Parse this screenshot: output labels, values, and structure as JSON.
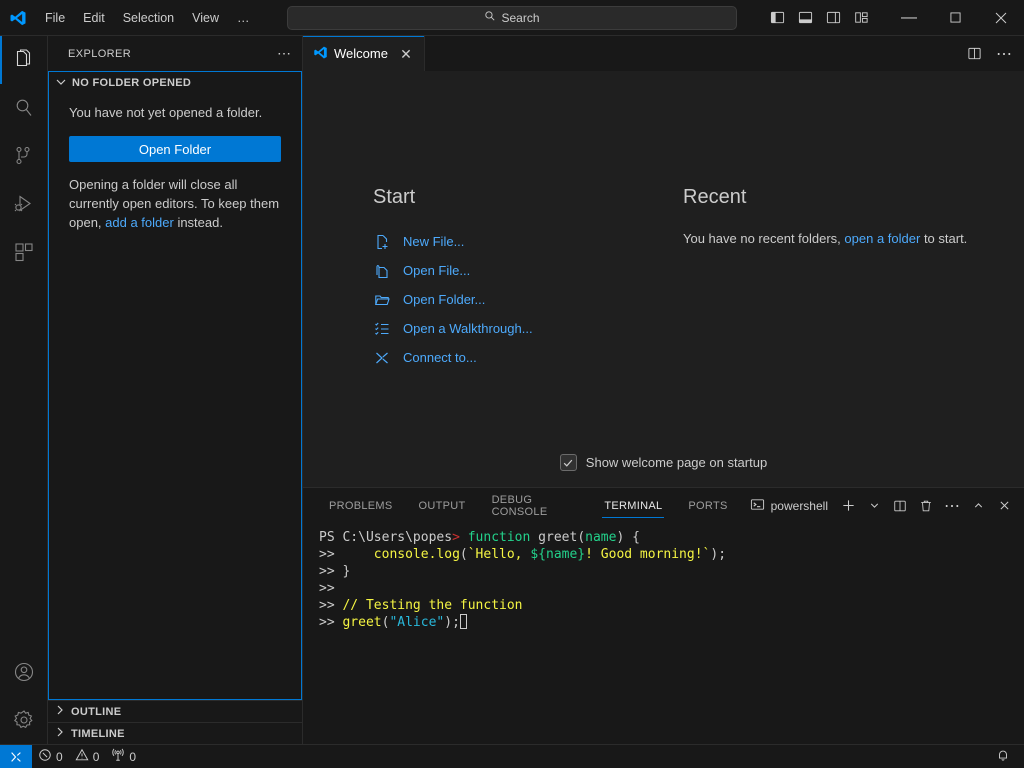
{
  "titlebar": {
    "logo_icon": "vscode-logo-icon",
    "menus": [
      {
        "label": "File"
      },
      {
        "label": "Edit"
      },
      {
        "label": "Selection"
      },
      {
        "label": "View"
      },
      {
        "label": "…"
      }
    ],
    "nav": {
      "back_icon": "arrow-left-icon",
      "forward_icon": "arrow-right-icon"
    },
    "search": {
      "placeholder": "Search",
      "value": "",
      "icon": "search-icon"
    },
    "layout_buttons": [
      {
        "name": "toggle-primary-sidebar"
      },
      {
        "name": "toggle-panel"
      },
      {
        "name": "toggle-secondary-sidebar"
      },
      {
        "name": "customize-layout"
      }
    ],
    "window_controls": {
      "minimize": "—",
      "maximize": "☐",
      "close": "✕"
    }
  },
  "activitybar": {
    "items": [
      {
        "name": "explorer",
        "icon": "files-icon",
        "active": true
      },
      {
        "name": "search",
        "icon": "search-icon",
        "active": false
      },
      {
        "name": "source-control",
        "icon": "source-control-icon",
        "active": false
      },
      {
        "name": "run-and-debug",
        "icon": "run-debug-icon",
        "active": false
      },
      {
        "name": "extensions",
        "icon": "extensions-icon",
        "active": false
      }
    ],
    "bottom": [
      {
        "name": "accounts",
        "icon": "account-icon"
      },
      {
        "name": "manage-settings",
        "icon": "gear-icon"
      }
    ]
  },
  "sidebar": {
    "title": "EXPLORER",
    "more_actions_icon": "ellipsis-icon",
    "section": {
      "label": "NO FOLDER OPENED",
      "chevron": "chevron-down-icon",
      "message": "You have not yet opened a folder.",
      "open_folder_button": "Open Folder",
      "note_prefix": "Opening a folder will close all currently open editors. To keep them open, ",
      "note_link": "add a folder",
      "note_suffix": " instead."
    },
    "collapsed_sections": [
      {
        "label": "OUTLINE",
        "chevron": "chevron-right-icon"
      },
      {
        "label": "TIMELINE",
        "chevron": "chevron-right-icon"
      }
    ]
  },
  "editor": {
    "tab": {
      "title": "Welcome",
      "icon": "vscode-logo-icon",
      "close_icon": "close-icon"
    },
    "actions": [
      {
        "name": "split-editor-right",
        "icon": "split-editor-icon"
      },
      {
        "name": "more-editor-actions",
        "icon": "ellipsis-icon"
      }
    ],
    "welcome": {
      "start_heading": "Start",
      "start_items": [
        {
          "label": "New File...",
          "icon": "new-file-icon"
        },
        {
          "label": "Open File...",
          "icon": "open-file-icon"
        },
        {
          "label": "Open Folder...",
          "icon": "folder-icon"
        },
        {
          "label": "Open a Walkthrough...",
          "icon": "walkthrough-icon"
        },
        {
          "label": "Connect to...",
          "icon": "remote-connect-icon"
        }
      ],
      "recent_heading": "Recent",
      "recent_text_prefix": "You have no recent folders, ",
      "recent_link": "open a folder",
      "recent_text_suffix": " to start.",
      "startup_checkbox_label": "Show welcome page on startup",
      "startup_checkbox_checked": true
    }
  },
  "panel": {
    "tabs": [
      {
        "label": "PROBLEMS",
        "active": false
      },
      {
        "label": "OUTPUT",
        "active": false
      },
      {
        "label": "DEBUG CONSOLE",
        "active": false
      },
      {
        "label": "TERMINAL",
        "active": true
      },
      {
        "label": "PORTS",
        "active": false
      }
    ],
    "shell_label": "powershell",
    "shell_icon": "terminal-icon",
    "actions": [
      {
        "name": "new-terminal",
        "icon": "plus-icon"
      },
      {
        "name": "terminal-profile-dropdown",
        "icon": "chevron-down-icon"
      },
      {
        "name": "split-terminal",
        "icon": "split-icon"
      },
      {
        "name": "kill-terminal",
        "icon": "trash-icon"
      },
      {
        "name": "panel-more-actions",
        "icon": "ellipsis-icon"
      },
      {
        "name": "maximize-panel",
        "icon": "chevron-up-icon"
      },
      {
        "name": "close-panel",
        "icon": "close-icon"
      }
    ],
    "terminal_lines": [
      {
        "segments": [
          {
            "text": "PS C:\\Users\\popes",
            "color": "white"
          },
          {
            "text": ">",
            "color": "red"
          },
          {
            "text": " ",
            "color": "white"
          },
          {
            "text": "function",
            "color": "green"
          },
          {
            "text": " greet",
            "color": "white"
          },
          {
            "text": "(",
            "color": "white"
          },
          {
            "text": "name",
            "color": "green"
          },
          {
            "text": ") {",
            "color": "white"
          }
        ]
      },
      {
        "segments": [
          {
            "text": ">>",
            "color": "white"
          },
          {
            "text": "     ",
            "color": "white"
          },
          {
            "text": "console.log",
            "color": "yellow"
          },
          {
            "text": "(",
            "color": "white"
          },
          {
            "text": "`Hello, ",
            "color": "yellow"
          },
          {
            "text": "${name}",
            "color": "green"
          },
          {
            "text": "! Good morning!`",
            "color": "yellow"
          },
          {
            "text": ");",
            "color": "white"
          }
        ]
      },
      {
        "segments": [
          {
            "text": ">> }",
            "color": "white"
          }
        ]
      },
      {
        "segments": [
          {
            "text": ">>",
            "color": "white"
          }
        ]
      },
      {
        "segments": [
          {
            "text": ">> ",
            "color": "white"
          },
          {
            "text": "// Testing the function",
            "color": "yellow"
          }
        ]
      },
      {
        "segments": [
          {
            "text": ">> ",
            "color": "white"
          },
          {
            "text": "greet",
            "color": "yellow"
          },
          {
            "text": "(",
            "color": "white"
          },
          {
            "text": "\"Alice\"",
            "color": "cyan"
          },
          {
            "text": ");",
            "color": "white"
          }
        ],
        "cursor": true
      }
    ]
  },
  "statusbar": {
    "remote_icon": "remote-indicator-icon",
    "items": [
      {
        "name": "errors",
        "icon": "error-icon",
        "value": "0"
      },
      {
        "name": "warnings",
        "icon": "warning-icon",
        "value": "0"
      },
      {
        "name": "ports",
        "icon": "radio-tower-icon",
        "value": "0"
      }
    ],
    "notifications_icon": "bell-icon"
  },
  "colors": {
    "accent": "#0078d4",
    "link": "#4daafc",
    "titlebar_bg": "#181818",
    "editor_bg": "#1f1f1f",
    "terminal_green": "#23d18b",
    "terminal_yellow": "#f5f543",
    "terminal_cyan": "#29b8db",
    "terminal_red": "#cd3131"
  }
}
